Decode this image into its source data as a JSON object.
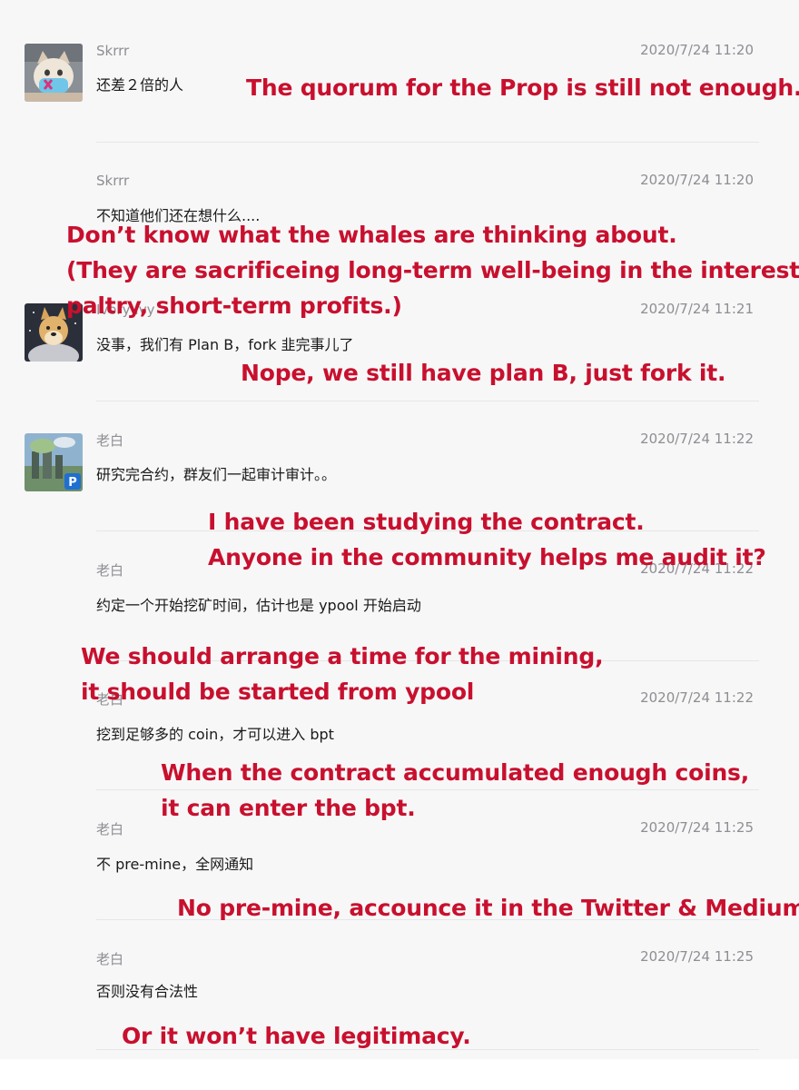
{
  "messages": [
    {
      "sender": "Skrrr",
      "time": "2020/7/24 11:20",
      "text": "还差２倍的人"
    },
    {
      "sender": "Skrrr",
      "time": "2020/7/24 11:20",
      "text": "不知道他们还在想什么...."
    },
    {
      "sender": "Ivory Ivy",
      "time": "2020/7/24 11:21",
      "text": "没事，我们有 Plan B，fork 韭完事儿了"
    },
    {
      "sender": "老白",
      "time": "2020/7/24 11:22",
      "text": "研究完合约，群友们一起审计审计。。"
    },
    {
      "sender": "老白",
      "time": "2020/7/24 11:22",
      "text": "约定一个开始挖矿时间，估计也是 ypool 开始启动"
    },
    {
      "sender": "老白",
      "time": "2020/7/24 11:22",
      "text": "挖到足够多的 coin，才可以进入 bpt"
    },
    {
      "sender": "老白",
      "time": "2020/7/24 11:25",
      "text": "不 pre-mine，全网通知"
    },
    {
      "sender": "老白",
      "time": "2020/7/24 11:25",
      "text": "否则没有合法性"
    }
  ],
  "translations": [
    {
      "lines": [
        "The quorum for the Prop is still not enough."
      ]
    },
    {
      "lines": [
        "Don’t know what the whales are thinking about.",
        "(They are sacrificeing long-term well-being in the interest of",
        "paltry, short-term profits.)"
      ]
    },
    {
      "lines": [
        "Nope, we still have plan B, just fork it."
      ]
    },
    {
      "lines": [
        "I have been studying the contract.",
        "Anyone in the community helps me audit it?"
      ]
    },
    {
      "lines": [
        "We should arrange a time for the mining,",
        "it should be started from ypool"
      ]
    },
    {
      "lines": [
        "When the contract accumulated enough coins,",
        "it can enter the bpt."
      ]
    },
    {
      "lines": [
        "No pre-mine, accounce it in the Twitter & Medium."
      ]
    },
    {
      "lines": [
        "Or it won’t have legitimacy."
      ]
    }
  ],
  "avatars": {
    "cat_with_mask": "cat-avatar",
    "doge_astronaut": "doge-avatar",
    "landscape_p_badge": "laobai-avatar"
  },
  "colors": {
    "annotation": "#c8102e",
    "meta_text": "#8e8e93",
    "background": "#f7f7f8"
  }
}
